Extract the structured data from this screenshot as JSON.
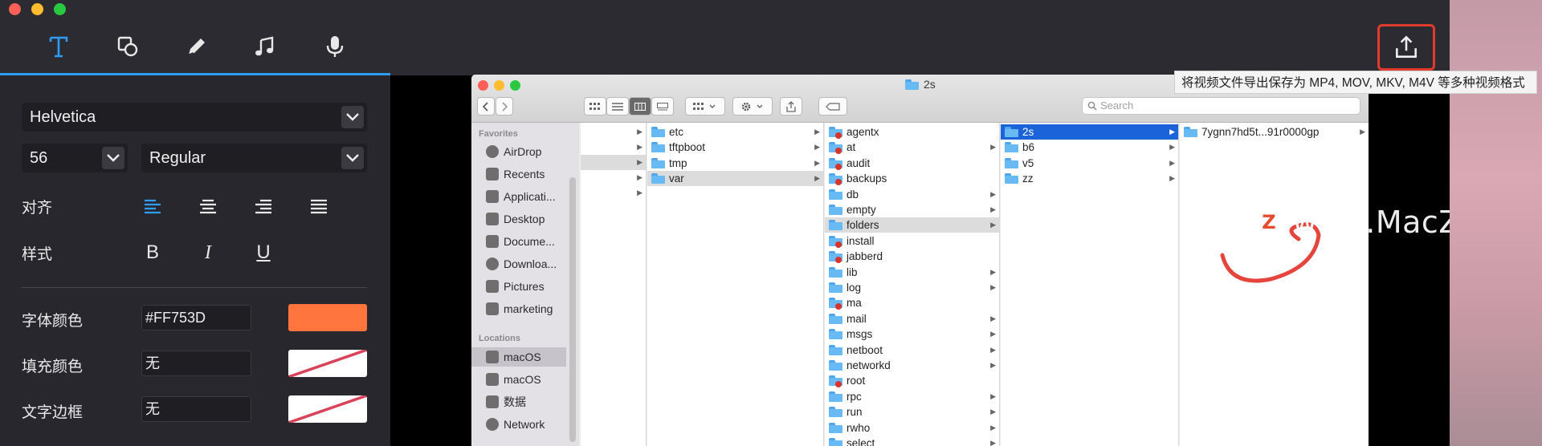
{
  "toolbar": {
    "tools": [
      "text-tool",
      "shape-tool",
      "pen-tool",
      "music-tool",
      "microphone-tool"
    ],
    "export_tooltip": "将视频文件导出保存为 MP4, MOV, MKV, M4V 等多种视频格式"
  },
  "panel": {
    "font_family": "Helvetica",
    "font_size": "56",
    "font_weight": "Regular",
    "align_label": "对齐",
    "style_label": "样式",
    "style_buttons": [
      "B",
      "I",
      "U"
    ],
    "font_color_label": "字体颜色",
    "font_color_value": "#FF753D",
    "font_color_swatch": "#FF753D",
    "fill_color_label": "填充颜色",
    "fill_color_value": "无",
    "border_label": "文字边框",
    "border_value": "无"
  },
  "finder": {
    "title": "2s",
    "search_placeholder": "Search",
    "sidebar": {
      "favorites_label": "Favorites",
      "favorites": [
        "AirDrop",
        "Recents",
        "Applicati...",
        "Desktop",
        "Docume...",
        "Downloa...",
        "Pictures",
        "marketing"
      ],
      "locations_label": "Locations",
      "locations": [
        "macOS",
        "macOS",
        "数据",
        "Network"
      ]
    },
    "col2": [
      "etc",
      "tftpboot",
      "tmp",
      "var"
    ],
    "col3": [
      "agentx",
      "at",
      "audit",
      "backups",
      "db",
      "empty",
      "folders",
      "install",
      "jabberd",
      "lib",
      "log",
      "ma",
      "mail",
      "msgs",
      "netboot",
      "networkd",
      "root",
      "rpc",
      "run",
      "rwho",
      "select"
    ],
    "col4": [
      "2s",
      "b6",
      "v5",
      "zz"
    ],
    "col5": [
      "7ygnn7hd5t...91r0000gp"
    ]
  },
  "watermark": {
    "logo": "Z",
    "text": "www.MacZ.com"
  }
}
